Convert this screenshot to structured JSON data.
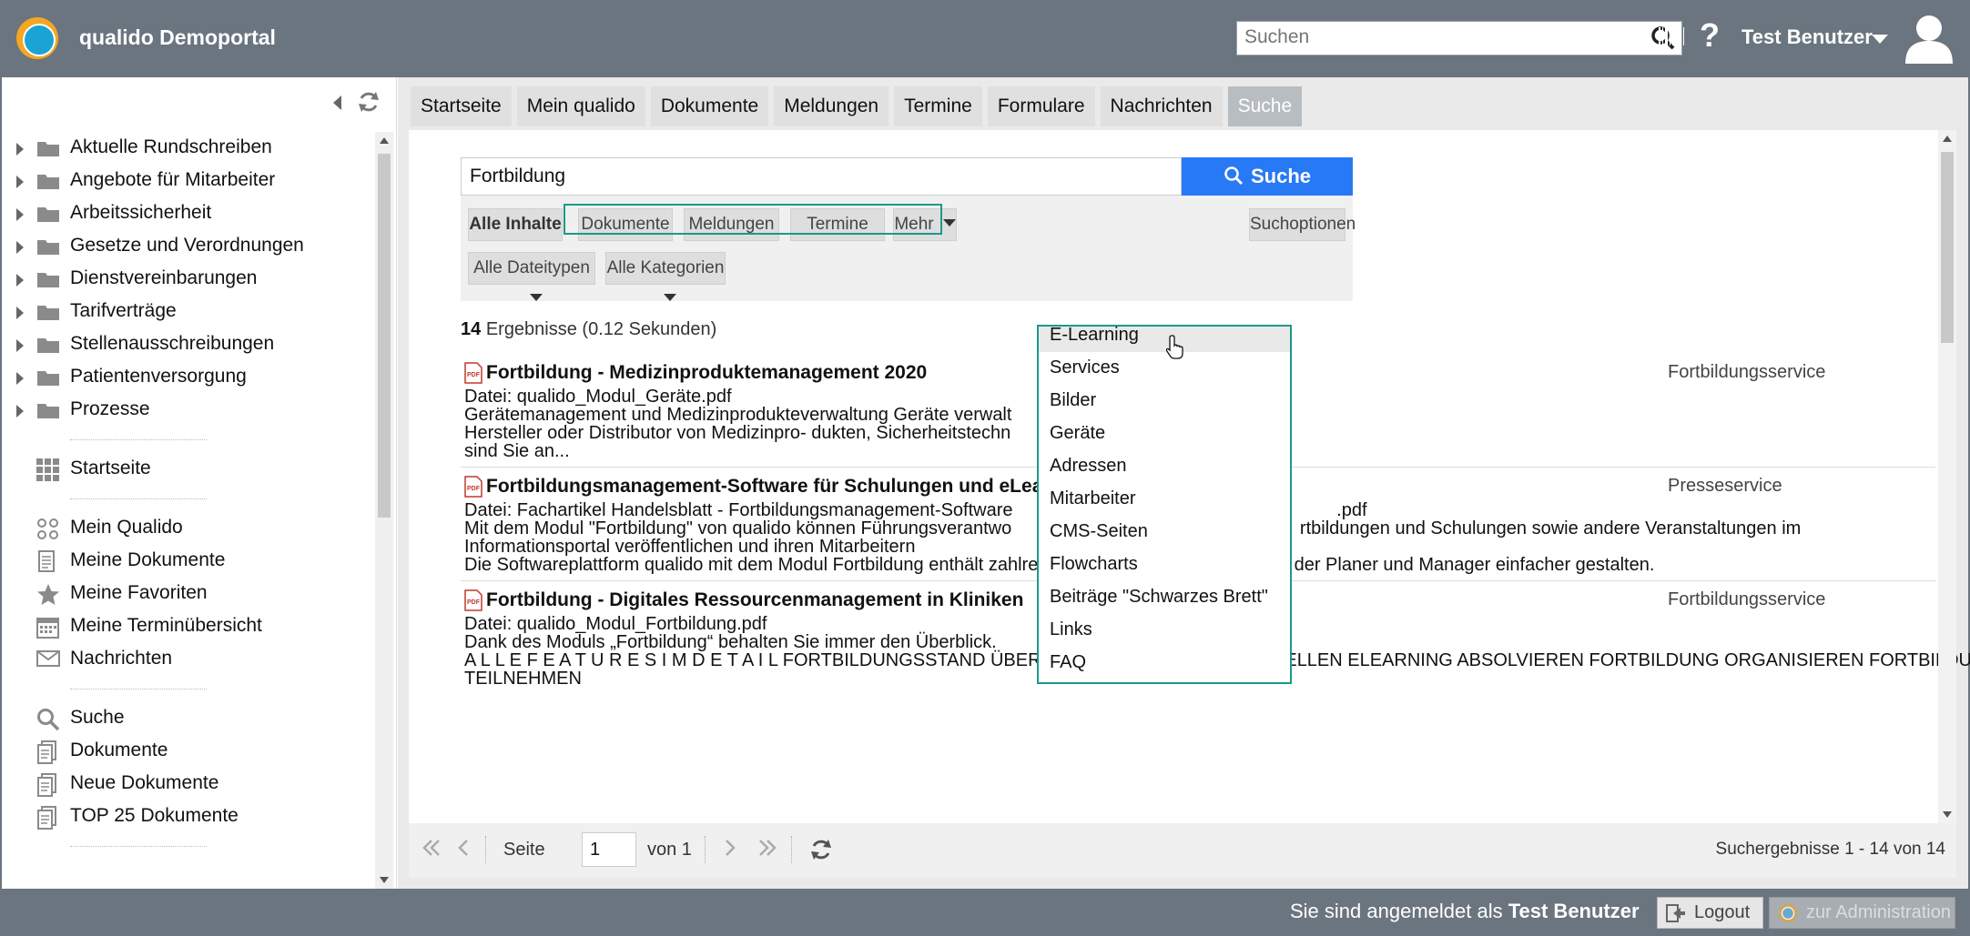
{
  "header": {
    "app_title": "qualido Demoportal",
    "search_placeholder": "Suchen",
    "help_label": "?",
    "user_name": "Test Benutzer"
  },
  "sidebar": {
    "tree": [
      "Aktuelle Rundschreiben",
      "Angebote für Mitarbeiter",
      "Arbeitssicherheit",
      "Gesetze und Verordnungen",
      "Dienstvereinbarungen",
      "Tarifverträge",
      "Stellenausschreibungen",
      "Patientenversorgung",
      "Prozesse"
    ],
    "nav_group1": [
      "Startseite"
    ],
    "nav_group2": [
      "Mein Qualido",
      "Meine Dokumente",
      "Meine Favoriten",
      "Meine Terminübersicht",
      "Nachrichten"
    ],
    "nav_group3": [
      "Suche",
      "Dokumente",
      "Neue Dokumente",
      "TOP 25 Dokumente"
    ]
  },
  "tabs": [
    "Startseite",
    "Mein qualido",
    "Dokumente",
    "Meldungen",
    "Termine",
    "Formulare",
    "Nachrichten",
    "Suche"
  ],
  "search": {
    "query": "Fortbildung",
    "button_label": "Suche",
    "filters": {
      "all": "Alle Inhalte",
      "documents": "Dokumente",
      "reports": "Meldungen",
      "dates": "Termine",
      "more": "Mehr",
      "options": "Suchoptionen",
      "file_types": "Alle Dateitypen",
      "categories": "Alle Kategorien"
    },
    "more_menu": [
      "E-Learning",
      "Services",
      "Bilder",
      "Geräte",
      "Adressen",
      "Mitarbeiter",
      "CMS-Seiten",
      "Flowcharts",
      "Beiträge \"Schwarzes Brett\"",
      "Links",
      "FAQ"
    ]
  },
  "results_summary": {
    "count": "14",
    "text": "Ergebnisse (0.12 Sekunden)"
  },
  "results": [
    {
      "title": "Fortbildung - Medizinproduktemanagement 2020",
      "category": "Fortbildungsservice",
      "lines": [
        "Datei: qualido_Modul_Geräte.pdf",
        "Gerätemanagement und Medizinprodukteverwaltung Geräte verwalt",
        "Hersteller oder Distributor von Medizinpro- dukten, Sicherheitstechn",
        "sind Sie an..."
      ]
    },
    {
      "title": "Fortbildungsmanagement-Software für Schulungen und eLea",
      "category": "Presseservice",
      "lines": [
        "Datei: Fachartikel Handelsblatt - Fortbildungsmanagement-Software                                                                .pdf",
        "Mit dem Modul \"Fortbildung\" von qualido können Führungsverantwo                                                         rtbildungen und Schulungen sowie andere Veranstaltungen im",
        "Informationsportal veröffentlichen und ihren Mitarbeitern",
        "Die Softwareplattform qualido mit dem Modul Fortbildung enthält zahlreiche Features, die das Arbeiten der Planer und Manager einfacher gestalten."
      ]
    },
    {
      "title": "Fortbildung - Digitales Ressourcenmanagement in Kliniken",
      "category": "Fortbildungsservice",
      "lines": [
        "Datei: qualido_Modul_Fortbildung.pdf",
        "Dank des Moduls „Fortbildung“ behalten Sie immer den Überblick.",
        "A L L E F E A T U R E S I M D E T A I L FORTBILDUNGSSTAND ÜBERWACHEN ELEARNING ERSTELLEN ELEARNING ABSOLVIEREN FORTBILDUNG ORGANISIEREN FORTBILDUNG",
        "TEILNEHMEN"
      ]
    }
  ],
  "pager": {
    "page_label": "Seite",
    "page_value": "1",
    "of_label": "von 1",
    "summary": "Suchergebnisse 1 - 14 von 14"
  },
  "footer": {
    "status_prefix": "Sie sind angemeldet als",
    "status_user": "Test Benutzer",
    "logout": "Logout",
    "admin": "zur Administration"
  },
  "colors": {
    "header_bg": "#6b7580",
    "search_button": "#2879f5",
    "highlight_border": "#1a9a8a"
  }
}
